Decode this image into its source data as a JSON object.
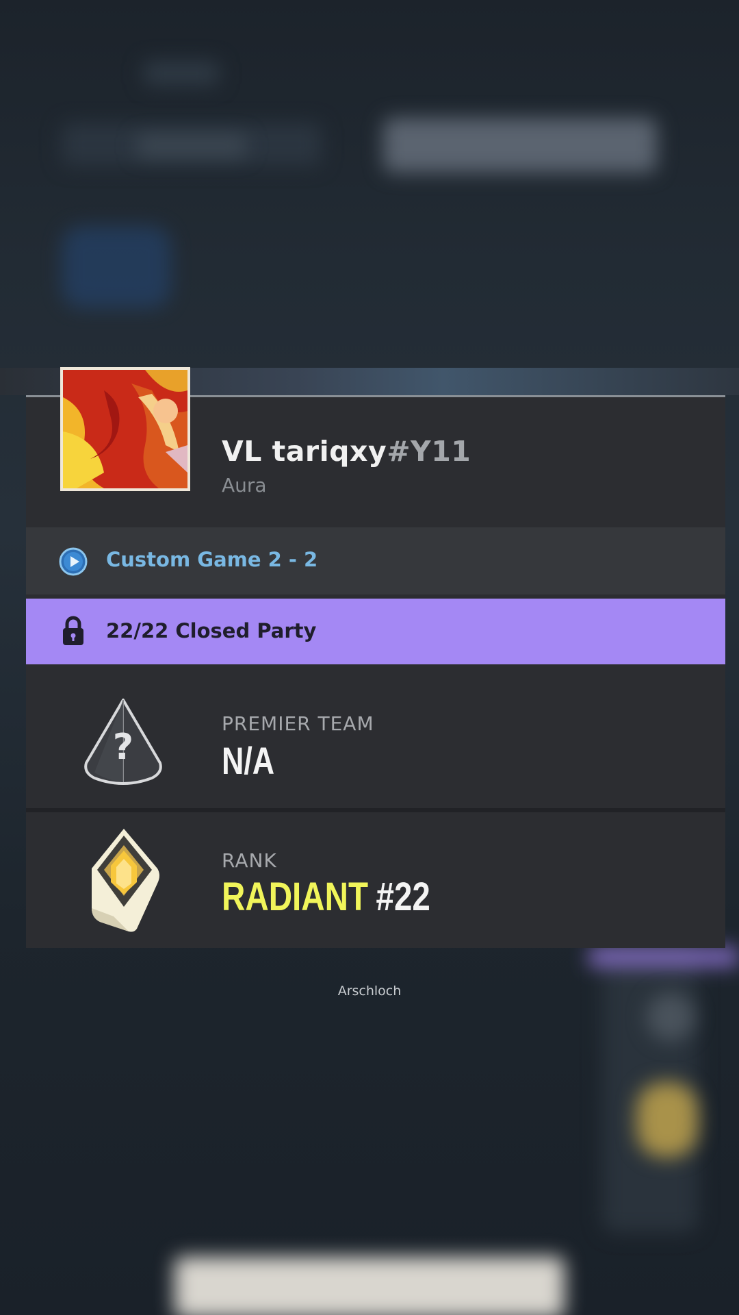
{
  "player": {
    "name": "VL tariqxy",
    "tag": "#Y11",
    "title": "Aura",
    "avatar_icon": "phoenix-card-icon"
  },
  "status": {
    "icon": "play-circle-icon",
    "text": "Custom Game  2 - 2",
    "color": "#79b8e3"
  },
  "party": {
    "icon": "lock-icon",
    "text": "22/22  Closed Party",
    "color": "#a488f4"
  },
  "premier": {
    "icon": "premier-unknown-icon",
    "label": "PREMIER TEAM",
    "value": "N/A"
  },
  "rank": {
    "icon": "radiant-rank-icon",
    "label": "RANK",
    "tier": "RADIANT",
    "position": "#22",
    "tier_color": "#f1f55a"
  },
  "caption": "Arschloch"
}
